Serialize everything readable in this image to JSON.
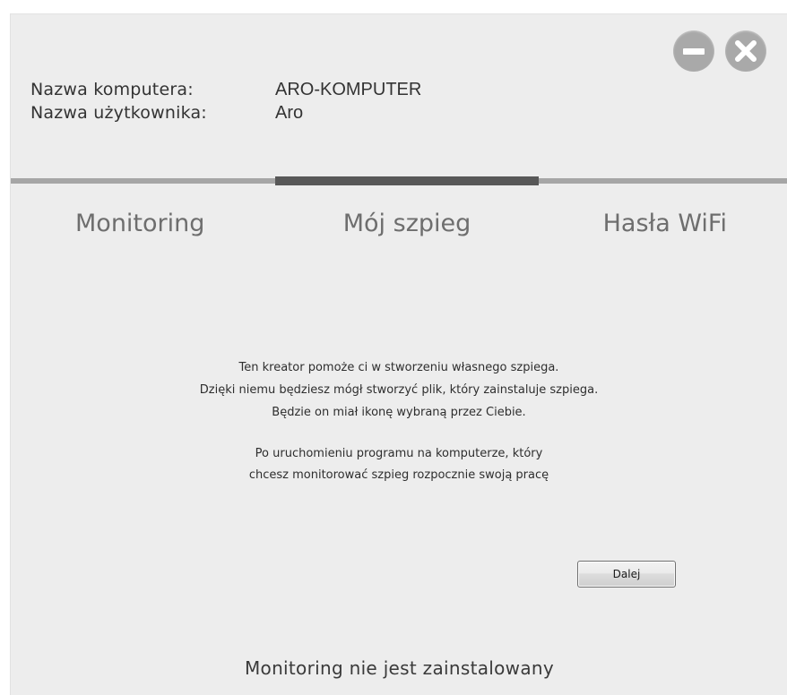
{
  "window_controls": {
    "minimize_icon": "minimize-icon",
    "close_icon": "close-icon"
  },
  "info": {
    "computer_label": "Nazwa komputera:",
    "computer_value": "ARO-KOMPUTER",
    "user_label": "Nazwa użytkownika:",
    "user_value": "Aro"
  },
  "tabs": [
    {
      "label": "Monitoring"
    },
    {
      "label": "Mój szpieg",
      "active": true
    },
    {
      "label": "Hasła WiFi"
    }
  ],
  "description": {
    "line1": "Ten kreator pomoże ci w stworzeniu własnego szpiega.",
    "line2": "Dzięki niemu będziesz mógł stworzyć plik, który zainstaluje szpiega.",
    "line3": "Będzie on miał ikonę wybraną przez Ciebie.",
    "line4": "Po uruchomieniu programu na komputerze, który",
    "line5": "chcesz monitorować szpieg rozpocznie swoją pracę"
  },
  "next_button": {
    "label": "Dalej"
  },
  "status": {
    "text": "Monitoring nie jest zainstalowany"
  },
  "colors": {
    "background": "#ededed",
    "tab_active": "#585858",
    "tab_inactive": "#a6a6a6",
    "control_icon": "#a9a9a9"
  }
}
